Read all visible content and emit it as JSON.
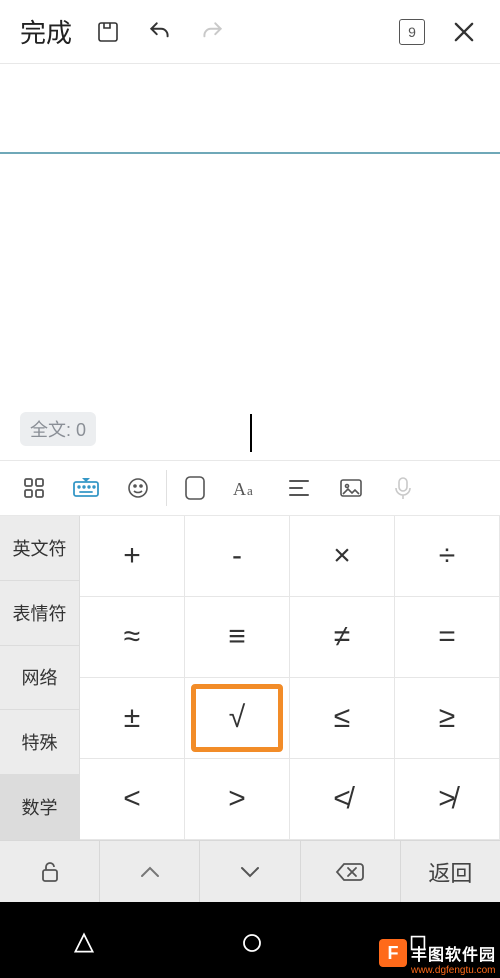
{
  "topbar": {
    "done_label": "完成",
    "page_number": "9"
  },
  "content": {
    "fulltext_label": "全文: 0"
  },
  "keyboard": {
    "categories": [
      {
        "label": "英文符",
        "active": false
      },
      {
        "label": "表情符",
        "active": false
      },
      {
        "label": "网络",
        "active": false
      },
      {
        "label": "特殊",
        "active": false
      },
      {
        "label": "数学",
        "active": true
      }
    ],
    "keys": [
      [
        "+",
        "-",
        "×",
        "÷"
      ],
      [
        "≈",
        "≡",
        "≠",
        "="
      ],
      [
        "±",
        "√",
        "≤",
        "≥"
      ],
      [
        "<",
        ">",
        "≮",
        "≯"
      ]
    ],
    "highlighted": "√",
    "back_label": "返回"
  },
  "watermark": {
    "brand": "丰图软件园",
    "url": "www.dgfengtu.com",
    "logo_letter": "F"
  }
}
